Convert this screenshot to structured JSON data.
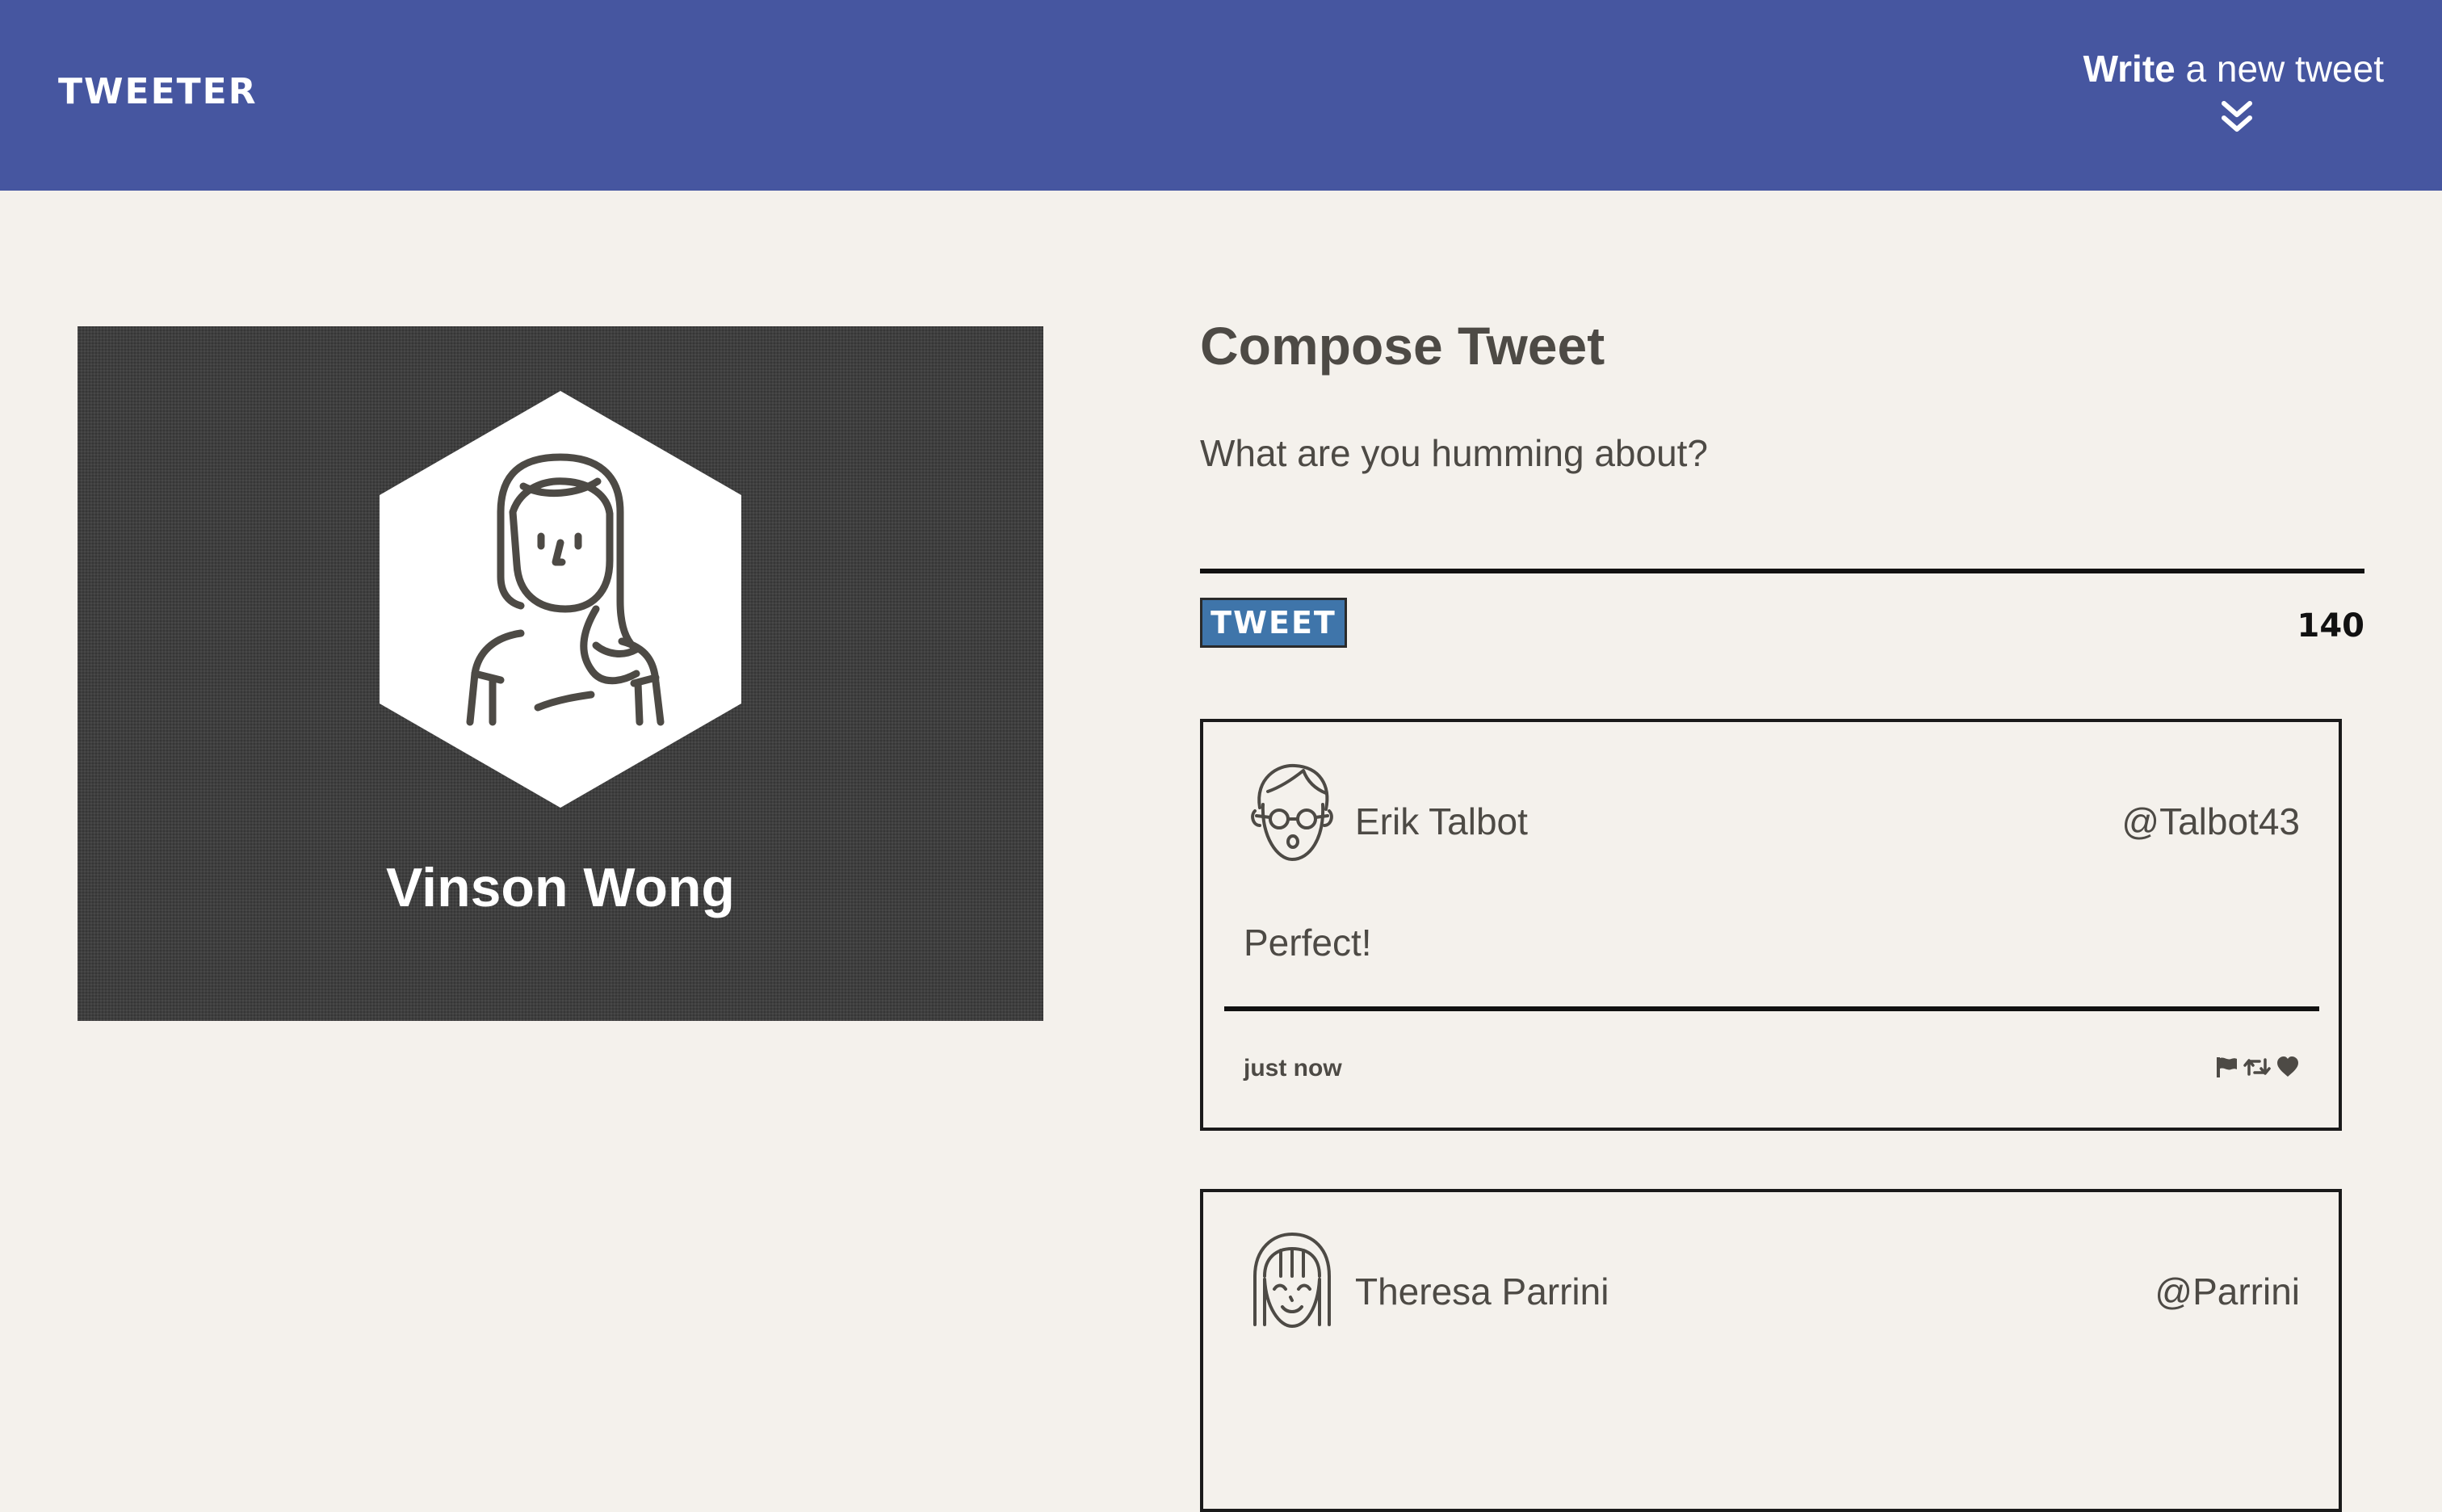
{
  "nav": {
    "brand": "TWEETER",
    "write_bold": "Write",
    "write_rest": " a new tweet",
    "chevron_icon": "double-chevron-down-icon",
    "background": "#4656a0"
  },
  "profile": {
    "name": "Vinson Wong",
    "avatar_icon": "female-avatar-icon"
  },
  "compose": {
    "title": "Compose Tweet",
    "placeholder": "What are you humming about?",
    "button_label": "TWEET",
    "char_count": "140",
    "button_color": "#3f75aa"
  },
  "tweets": [
    {
      "name": "Erik Talbot",
      "handle": "@Talbot43",
      "content": "Perfect!",
      "time": "just now",
      "avatar_icon": "male-glasses-avatar-icon",
      "actions": [
        "flag-icon",
        "retweet-icon",
        "heart-icon"
      ]
    },
    {
      "name": "Theresa Parrini",
      "handle": "@Parrini",
      "avatar_icon": "female-bangs-avatar-icon"
    }
  ]
}
